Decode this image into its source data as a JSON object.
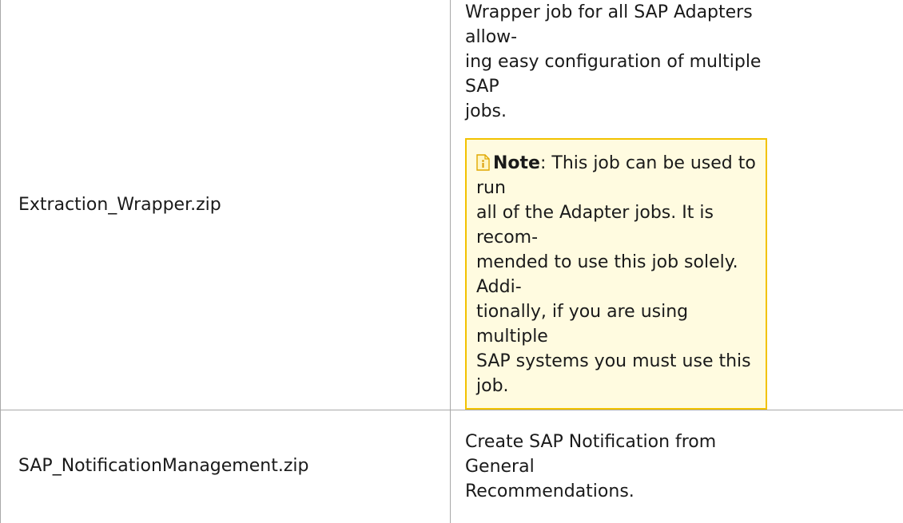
{
  "rows": [
    {
      "file": "Extraction_Wrapper.zip",
      "description_lines": [
        "Wrapper job for all SAP Adapters allow-",
        "ing easy configuration of multiple SAP",
        "jobs."
      ],
      "note": {
        "icon": "note-icon",
        "label": "Note",
        "separator": ": ",
        "text_lines": [
          "This job can be used to run",
          "all of the Adapter jobs. It is recom-",
          "mended to use this job solely. Addi-",
          "tionally, if you are using multiple",
          "SAP systems you must use this job."
        ]
      }
    },
    {
      "file": "SAP_NotificationManagement.zip",
      "description_lines": [
        "Create SAP Notification from General",
        "Recommendations."
      ]
    }
  ],
  "colors": {
    "note_background": "#fffbe0",
    "note_border": "#f2c200",
    "table_border": "#a9a9a9"
  }
}
